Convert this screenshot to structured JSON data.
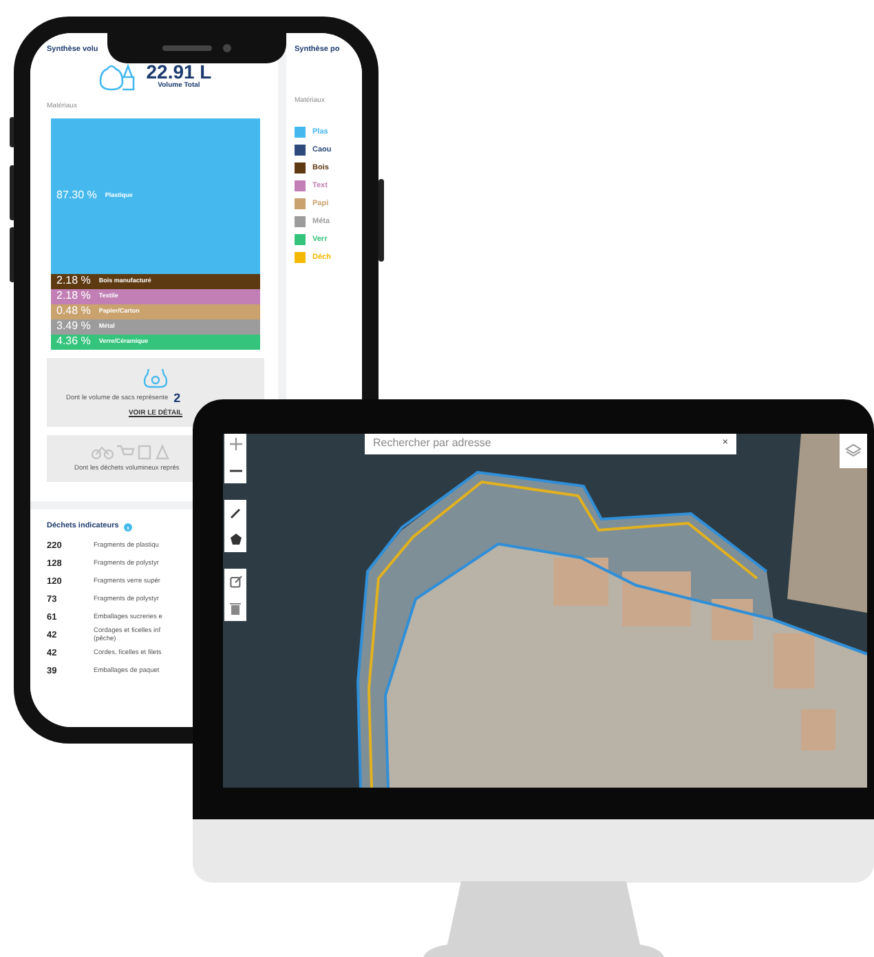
{
  "phone": {
    "volume_panel": {
      "title": "Synthèse volu",
      "total": "22.91 L",
      "total_label": "Volume Total",
      "materials_label": "Matériaux",
      "materials": [
        {
          "share": "87.30 %",
          "label": "Plastique",
          "color": "#45b9ee"
        },
        {
          "share": "2.18 %",
          "label": "Bois manufacturé",
          "color": "#5e3a12"
        },
        {
          "share": "2.18 %",
          "label": "Textile",
          "color": "#c27fb5"
        },
        {
          "share": "0.48 %",
          "label": "Papier/Carton",
          "color": "#c9a26e"
        },
        {
          "share": "3.49 %",
          "label": "Métal",
          "color": "#9c9c9c"
        },
        {
          "share": "4.36 %",
          "label": "Verre/Céramique",
          "color": "#35c47c"
        }
      ]
    },
    "bags_card": {
      "text": "Dont le volume de sacs représente",
      "value": "2",
      "link": "VOIR LE DÉTAIL"
    },
    "bulky_card": {
      "text": "Dont les déchets volumineux représ"
    },
    "indicators": {
      "title": "Déchets indicateurs",
      "rows": [
        {
          "count": "220",
          "label": "Fragments de plastiqu"
        },
        {
          "count": "128",
          "label": "Fragments de polystyr"
        },
        {
          "count": "120",
          "label": "Fragments verre supér"
        },
        {
          "count": "73",
          "label": "Fragments de polystyr"
        },
        {
          "count": "61",
          "label": "Emballages sucreries e"
        },
        {
          "count": "42",
          "label": "Cordages et ficelles inf\n(pêche)"
        },
        {
          "count": "42",
          "label": "Cordes, ficelles et filets"
        },
        {
          "count": "39",
          "label": "Emballages de paquet"
        }
      ]
    },
    "composition_panel": {
      "title": "Synthèse po",
      "materials_label": "Matériaux",
      "legend": [
        {
          "label": "Plas",
          "color": "#45b9ee"
        },
        {
          "label": "Caou",
          "color": "#2d4a7a"
        },
        {
          "label": "Bois",
          "color": "#5e3a12"
        },
        {
          "label": "Text",
          "color": "#c27fb5"
        },
        {
          "label": "Papi",
          "color": "#c9a26e"
        },
        {
          "label": "Méta",
          "color": "#9c9c9c"
        },
        {
          "label": "Verr",
          "color": "#35c47c"
        },
        {
          "label": "Déch",
          "color": "#f5b800"
        }
      ]
    }
  },
  "monitor": {
    "map": {
      "search": {
        "placeholder": "Rechercher par adresse"
      },
      "clear": "×"
    }
  }
}
